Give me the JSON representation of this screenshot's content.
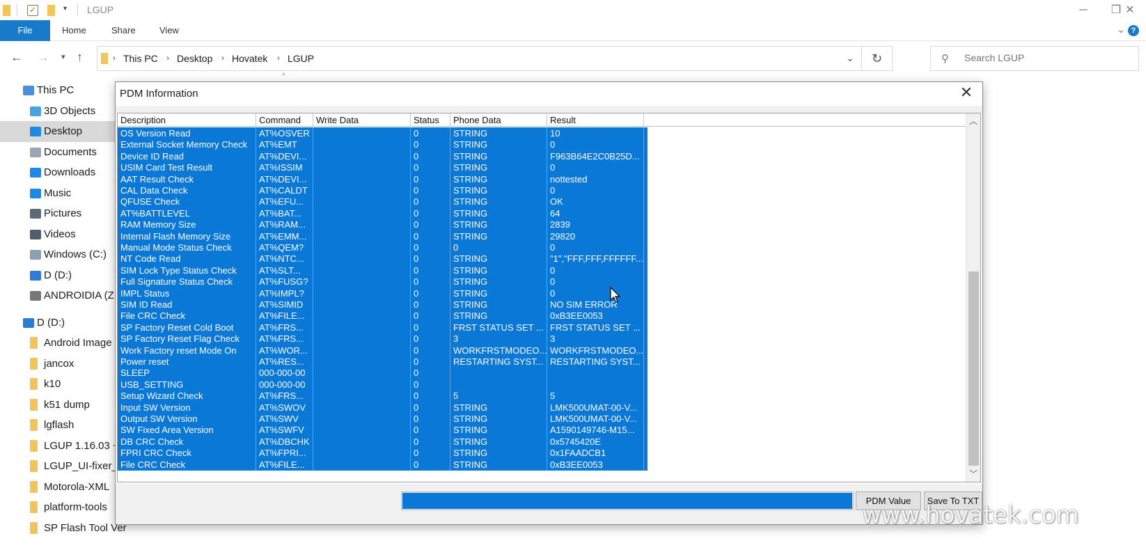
{
  "window": {
    "title": "LGUP"
  },
  "ribbon": {
    "file": "File",
    "tabs": [
      "Home",
      "Share",
      "View"
    ]
  },
  "address": {
    "crumbs": [
      "This PC",
      "Desktop",
      "Hovatek",
      "LGUP"
    ]
  },
  "search": {
    "placeholder": "Search LGUP"
  },
  "navpane": {
    "items": [
      {
        "label": "This PC",
        "icon": "computer-icon"
      },
      {
        "label": "3D Objects",
        "icon": "cube-icon"
      },
      {
        "label": "Desktop",
        "icon": "desktop-icon",
        "selected": true
      },
      {
        "label": "Documents",
        "icon": "document-icon"
      },
      {
        "label": "Downloads",
        "icon": "download-arrow-icon"
      },
      {
        "label": "Music",
        "icon": "music-note-icon"
      },
      {
        "label": "Pictures",
        "icon": "picture-icon"
      },
      {
        "label": "Videos",
        "icon": "film-icon"
      },
      {
        "label": "Windows (C:)",
        "icon": "drive-icon"
      },
      {
        "label": "D (D:)",
        "icon": "user-drive-icon"
      },
      {
        "label": "ANDROIDIA (Z",
        "icon": "usb-drive-icon"
      },
      {
        "label": "D (D:)",
        "icon": "user-drive-icon"
      },
      {
        "label": "Android Image",
        "icon": "folder-icon"
      },
      {
        "label": "jancox",
        "icon": "folder-icon"
      },
      {
        "label": "k10",
        "icon": "folder-icon"
      },
      {
        "label": "k51 dump",
        "icon": "folder-icon"
      },
      {
        "label": "lgflash",
        "icon": "folder-icon"
      },
      {
        "label": "LGUP 1.16.03 +",
        "icon": "folder-icon"
      },
      {
        "label": "LGUP_UI-fixer_",
        "icon": "folder-icon"
      },
      {
        "label": "Motorola-XML",
        "icon": "folder-icon"
      },
      {
        "label": "platform-tools",
        "icon": "folder-icon"
      },
      {
        "label": "SP Flash Tool Ver",
        "icon": "folder-icon"
      }
    ]
  },
  "dialog": {
    "title": "PDM Information",
    "columns": [
      "Description",
      "Command",
      "Write Data",
      "Status",
      "Phone Data",
      "Result"
    ],
    "rows": [
      [
        "OS Version Read",
        "AT%OSVER",
        "",
        "0",
        "STRING",
        "10"
      ],
      [
        "External Socket Memory Check",
        "AT%EMT",
        "",
        "0",
        "STRING",
        "0"
      ],
      [
        "Device ID Read",
        "AT%DEVI...",
        "",
        "0",
        "STRING",
        "F963B64E2C0B25D..."
      ],
      [
        "USIM Card Test Result",
        "AT%ISSIM",
        "",
        "0",
        "STRING",
        "0"
      ],
      [
        "AAT Result Check",
        "AT%DEVI...",
        "",
        "0",
        "STRING",
        "nottested"
      ],
      [
        "CAL Data Check",
        "AT%CALDT",
        "",
        "0",
        "STRING",
        "0"
      ],
      [
        "QFUSE Check",
        "AT%EFU...",
        "",
        "0",
        "STRING",
        "OK"
      ],
      [
        "AT%BATTLEVEL",
        "AT%BAT...",
        "",
        "0",
        "STRING",
        "64"
      ],
      [
        "RAM Memory Size",
        "AT%RAM...",
        "",
        "0",
        "STRING",
        "2839"
      ],
      [
        "Internal Flash Memory Size",
        "AT%EMM...",
        "",
        "0",
        "STRING",
        "29820"
      ],
      [
        "Manual Mode Status Check",
        "AT%QEM?",
        "",
        "0",
        "0",
        "0"
      ],
      [
        "NT Code Read",
        "AT%NTC...",
        "",
        "0",
        "STRING",
        "\"1\",\"FFF,FFF,FFFFFF..."
      ],
      [
        "SIM Lock Type Status Check",
        "AT%SLT...",
        "",
        "0",
        "STRING",
        "0"
      ],
      [
        "Full Signature Status Check",
        "AT%FUSG?",
        "",
        "0",
        "STRING",
        "0"
      ],
      [
        "IMPL Status",
        "AT%IMPL?",
        "",
        "0",
        "STRING",
        "0"
      ],
      [
        "SIM ID Read",
        "AT%SIMID",
        "",
        "0",
        "STRING",
        "NO SIM ERROR"
      ],
      [
        "File CRC Check",
        "AT%FILE...",
        "",
        "0",
        "STRING",
        "0xB3EE0053"
      ],
      [
        "SP Factory Reset Cold Boot",
        "AT%FRS...",
        "",
        "0",
        "FRST STATUS SET ...",
        "FRST STATUS SET ..."
      ],
      [
        "SP Factory Reset Flag Check",
        "AT%FRS...",
        "",
        "0",
        "3",
        "3"
      ],
      [
        "Work Factory reset Mode On",
        "AT%WOR...",
        "",
        "0",
        "WORKFRSTMODEO...",
        "WORKFRSTMODEO..."
      ],
      [
        "Power reset",
        "AT%RES...",
        "",
        "0",
        "RESTARTING SYST...",
        "RESTARTING SYST..."
      ],
      [
        "SLEEP",
        "000-000-00",
        "",
        "0",
        "",
        ""
      ],
      [
        "USB_SETTING",
        "000-000-00",
        "",
        "0",
        "",
        ""
      ],
      [
        "Setup Wizard Check",
        "AT%FRS...",
        "",
        "0",
        "5",
        "5"
      ],
      [
        "Input SW Version",
        "AT%SWOV",
        "",
        "0",
        "STRING",
        "LMK500UMAT-00-V..."
      ],
      [
        "Output SW Version",
        "AT%SWV",
        "",
        "0",
        "STRING",
        "LMK500UMAT-00-V..."
      ],
      [
        "SW Fixed Area Version",
        "AT%SWFV",
        "",
        "0",
        "STRING",
        "A1590149746-M15..."
      ],
      [
        "DB CRC Check",
        "AT%DBCHK",
        "",
        "0",
        "STRING",
        "0x5745420E"
      ],
      [
        "FPRI CRC Check",
        "AT%FPRI...",
        "",
        "0",
        "STRING",
        "0x1FAADCB1"
      ],
      [
        "File CRC Check",
        "AT%FILE...",
        "",
        "0",
        "STRING",
        "0xB3EE0053"
      ]
    ],
    "progress": 1.0,
    "buttons": {
      "pdm_value": "PDM Value",
      "save_txt": "Save To TXT"
    }
  },
  "watermark": "www.hovatek.com",
  "colors": {
    "selection": "#0a78d7",
    "file_tab": "#1979ca",
    "folder": "#f2c55c"
  }
}
